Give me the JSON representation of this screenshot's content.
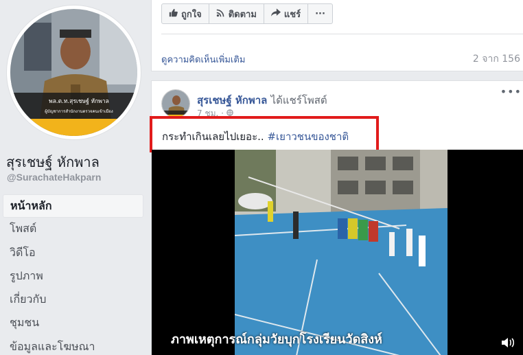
{
  "profile": {
    "name": "สุรเชษฐ์ หักพาล",
    "handle": "@SurachateHakparn",
    "photo_caption_line1": "พล.ต.ท.สุรเชษฐ์ หักพาล",
    "photo_caption_line2": "ผู้บัญชาการสำนักงานตรวจคนเข้าเมือง"
  },
  "nav": {
    "items": [
      {
        "label": "หน้าหลัก",
        "active": true
      },
      {
        "label": "โพสต์"
      },
      {
        "label": "วิดีโอ"
      },
      {
        "label": "รูปภาพ"
      },
      {
        "label": "เกี่ยวกับ"
      },
      {
        "label": "ชุมชน"
      },
      {
        "label": "ข้อมูลและโฆษณา"
      }
    ]
  },
  "top_card": {
    "like_label": "ถูกใจ",
    "follow_label": "ติดตาม",
    "share_label": "แชร์",
    "more_label": "···",
    "more_comments_label": "ดูความคิดเห็นเพิ่มเติม",
    "comment_count": "2 จาก 156"
  },
  "post": {
    "author": "สุรเชษฐ์ หักพาล",
    "shared_text": "ได้แชร์โพสต์",
    "time": "7 ชม. ·",
    "text": "กระทำเกินเลยไปเยอะ..",
    "hashtag": "#เยาวชนของชาติ",
    "menu_label": "•••",
    "video_caption": "ภาพเหตุการณ์กลุ่มวัยบุกโรงเรียนวัดสิงห์"
  },
  "colors": {
    "link": "#385898",
    "highlight_border": "#e11b1b",
    "page_bg": "#e9ebee",
    "court": "#3a8bc2"
  },
  "icons": [
    "thumbs-up-icon",
    "rss-icon",
    "share-arrow-icon",
    "globe-icon",
    "volume-icon"
  ]
}
